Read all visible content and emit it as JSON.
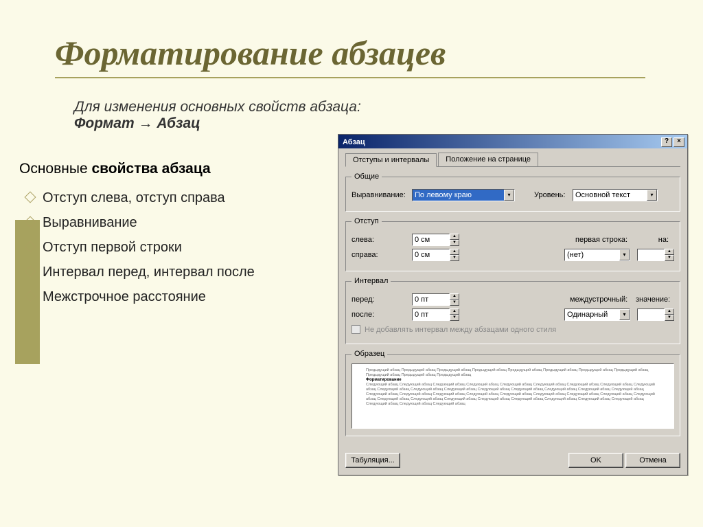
{
  "slide": {
    "title": "Форматирование абзацев",
    "intro_line": "Для изменения основных свойств абзаца:",
    "path_format": "Формат",
    "path_arrow": "→",
    "path_abzac": "Абзац",
    "subtitle_a": "Основные ",
    "subtitle_b": "свойства абзаца",
    "bullets": [
      "Отступ слева, отступ справа",
      "Выравнивание",
      "Отступ первой строки",
      "Интервал перед, интервал после",
      "Межстрочное расстояние"
    ]
  },
  "dialog": {
    "title": "Абзац",
    "help_glyph": "?",
    "close_glyph": "×",
    "tabs": {
      "active": "Отступы и интервалы",
      "other": "Положение на странице"
    },
    "general": {
      "legend": "Общие",
      "align_label": "Выравнивание:",
      "align_value": "По левому краю",
      "level_label": "Уровень:",
      "level_value": "Основной текст"
    },
    "indent": {
      "legend": "Отступ",
      "left_label": "слева:",
      "left_value": "0 см",
      "right_label": "справа:",
      "right_value": "0 см",
      "firstline_label": "первая строка:",
      "firstline_value": "(нет)",
      "na_label": "на:"
    },
    "interval": {
      "legend": "Интервал",
      "before_label": "перед:",
      "before_value": "0 пт",
      "after_label": "после:",
      "after_value": "0 пт",
      "linespacing_label": "междустрочный:",
      "linespacing_value": "Одинарный",
      "value_label": "значение:",
      "checkbox_label": "Не добавлять интервал между абзацами одного стиля"
    },
    "preview_legend": "Образец",
    "buttons": {
      "tabs": "Табуляция...",
      "ok": "OK",
      "cancel": "Отмена"
    }
  }
}
